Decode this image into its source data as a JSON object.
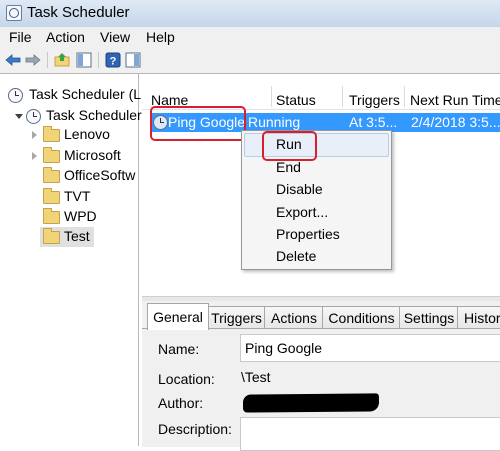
{
  "window": {
    "title": "Task Scheduler"
  },
  "menu": {
    "items": [
      "File",
      "Action",
      "View",
      "Help"
    ]
  },
  "toolbar": {
    "icons": [
      "back-arrow-icon",
      "forward-arrow-icon",
      "up-folder-icon",
      "show-hide-pane-icon",
      "help-icon",
      "properties-pane-icon"
    ]
  },
  "tree": {
    "root": "Task Scheduler (L",
    "library": "Task Scheduler",
    "folders": [
      "Lenovo",
      "Microsoft",
      "OfficeSoftw",
      "TVT",
      "WPD",
      "Test"
    ],
    "selected": "Test"
  },
  "list": {
    "columns": [
      "Name",
      "Status",
      "Triggers",
      "Next Run Time"
    ],
    "rows": [
      {
        "name": "Ping Google",
        "status": "Running",
        "triggers": "At 3:5...",
        "next_run": "2/4/2018 3:5..."
      }
    ]
  },
  "context_menu": {
    "items": [
      "Run",
      "End",
      "Disable",
      "Export...",
      "Properties",
      "Delete"
    ],
    "hovered": "Run"
  },
  "tabs": {
    "items": [
      "General",
      "Triggers",
      "Actions",
      "Conditions",
      "Settings",
      "History"
    ],
    "active": "General"
  },
  "general": {
    "name_label": "Name:",
    "name_value": "Ping Google",
    "location_label": "Location:",
    "location_value": "\\Test",
    "author_label": "Author:",
    "author_value": "",
    "description_label": "Description:"
  },
  "annotations": {
    "highlight_color": "#d62030"
  },
  "colors": {
    "selection": "#3399ff",
    "titlebar": "#c5d6ea"
  }
}
